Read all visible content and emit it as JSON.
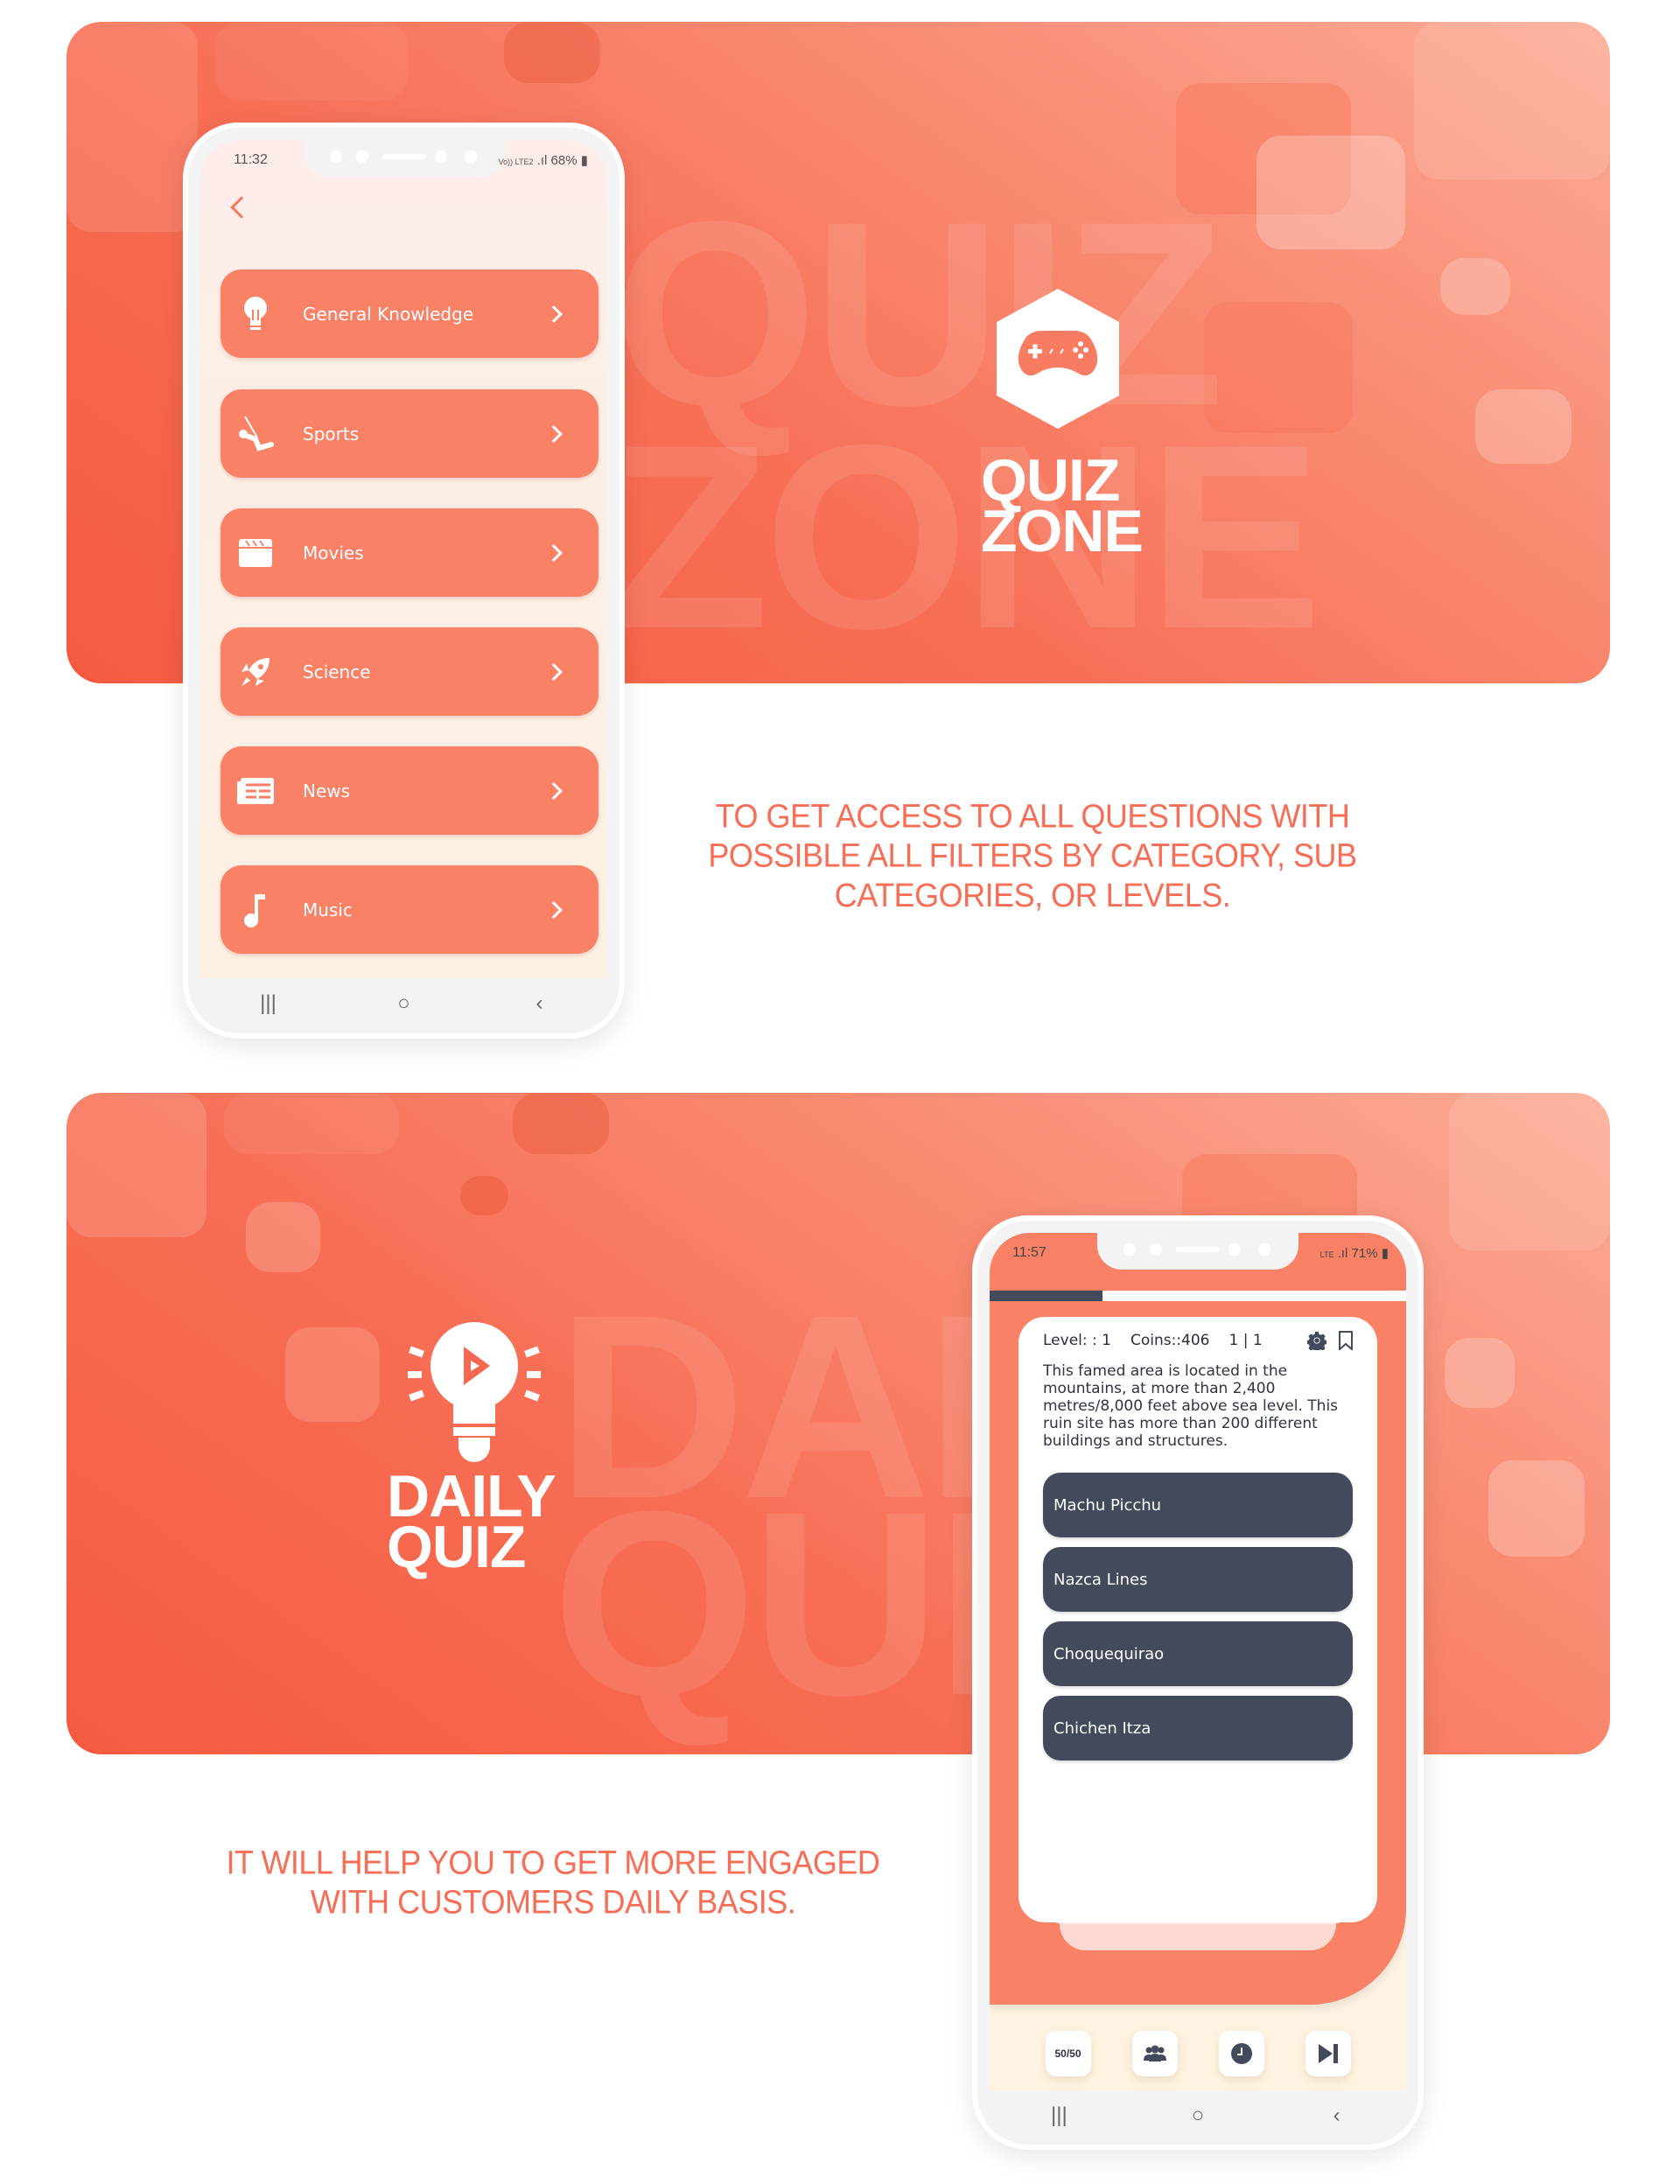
{
  "section1": {
    "banner": {
      "watermark_lines": [
        "QUIZ",
        "ZONE"
      ],
      "logo_icon": "gamepad-hexagon-icon",
      "logo_lines": [
        "QUIZ",
        "ZONE"
      ]
    },
    "phone": {
      "status": {
        "time": "11:32",
        "network": "Vo)) LTE2",
        "battery": "68%"
      },
      "back_icon": "chevron-left-icon",
      "categories": [
        {
          "label": "General Knowledge",
          "icon": "lightbulb-icon"
        },
        {
          "label": "Sports",
          "icon": "swing-icon"
        },
        {
          "label": "Movies",
          "icon": "clapperboard-icon"
        },
        {
          "label": "Science",
          "icon": "rocket-icon"
        },
        {
          "label": "News",
          "icon": "newspaper-icon"
        },
        {
          "label": "Music",
          "icon": "music-note-icon"
        }
      ],
      "nav": {
        "recents": "|||",
        "home": "○",
        "back": "‹"
      }
    },
    "caption": "TO GET ACCESS TO ALL QUESTIONS WITH POSSIBLE ALL FILTERS BY CATEGORY, SUB CATEGORIES, OR LEVELS."
  },
  "section2": {
    "banner": {
      "watermark_lines": [
        "DAILY",
        "QUIZ"
      ],
      "logo_icon": "lightbulb-play-icon",
      "logo_lines": [
        "DAILY",
        "QUIZ"
      ]
    },
    "phone": {
      "status": {
        "time": "11:57",
        "network": "LTE",
        "battery": "71%"
      },
      "progress": 0.27,
      "meta": {
        "level": "Level: : 1",
        "coins": "Coins::406",
        "count": "1 | 1"
      },
      "question": "This famed area is located in the mountains, at more than 2,400 metres/8,000 feet above sea level. This ruin site has more than 200 different buildings and structures.",
      "options": [
        "Machu Picchu",
        "Nazca Lines",
        "Choquequirao",
        "Chichen Itza"
      ],
      "lifelines": [
        {
          "name": "fifty-fifty",
          "label": "50/50"
        },
        {
          "name": "audience-poll",
          "label": ""
        },
        {
          "name": "timer",
          "label": ""
        },
        {
          "name": "skip",
          "label": ""
        }
      ],
      "nav": {
        "recents": "|||",
        "home": "○",
        "back": "‹"
      }
    },
    "caption": "IT WILL HELP YOU TO GET MORE ENGAGED WITH CUSTOMERS DAILY BASIS."
  },
  "colors": {
    "accent": "#f88166",
    "banner_dark": "#f55a40",
    "banner_light": "#fcab95",
    "option_bg": "#434a5c",
    "caption": "#f76d55"
  }
}
